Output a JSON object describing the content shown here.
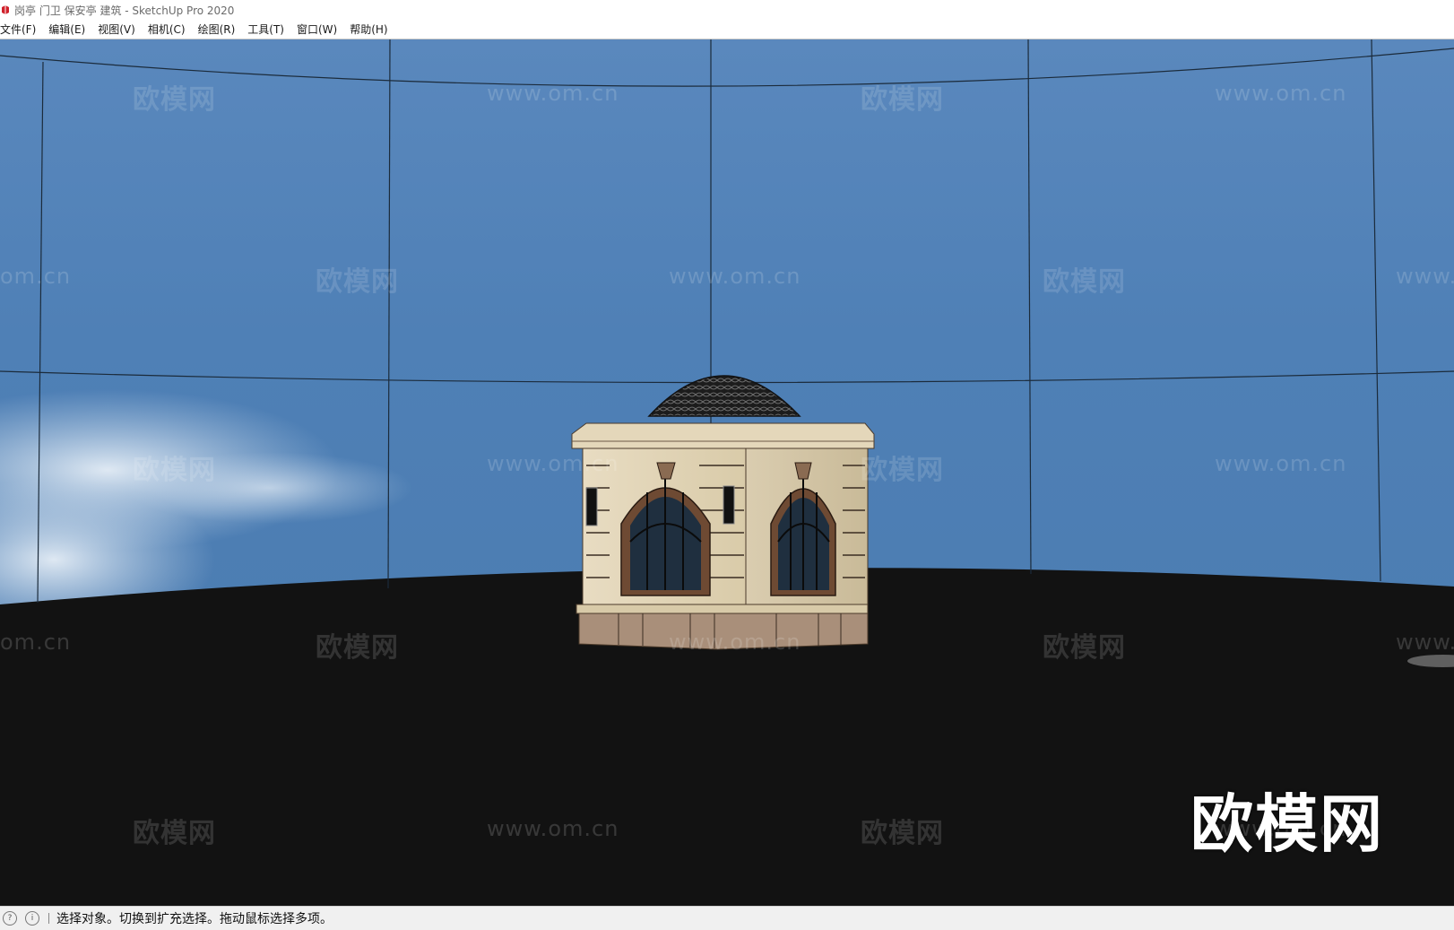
{
  "window": {
    "title": "岗亭 门卫 保安亭 建筑 - SketchUp Pro 2020",
    "app_icon": "sketchup-logo-icon",
    "app_icon_color": "#d0212b"
  },
  "menu": {
    "items": [
      {
        "label": "文件(F)"
      },
      {
        "label": "编辑(E)"
      },
      {
        "label": "视图(V)"
      },
      {
        "label": "相机(C)"
      },
      {
        "label": "绘图(R)"
      },
      {
        "label": "工具(T)"
      },
      {
        "label": "窗口(W)"
      },
      {
        "label": "帮助(H)"
      }
    ]
  },
  "viewport": {
    "sky_color": "#4d7fb5",
    "ground_color": "#121212",
    "model": "guard-booth-with-dome"
  },
  "watermarks": {
    "cn": "欧模网",
    "url": "www.om.cn",
    "partial_url": "om.cn",
    "partial_www": "www.",
    "big_logo": "欧模网"
  },
  "status": {
    "icons": [
      "geo-location-icon",
      "info-icon"
    ],
    "message": "选择对象。切换到扩充选择。拖动鼠标选择多项。"
  }
}
